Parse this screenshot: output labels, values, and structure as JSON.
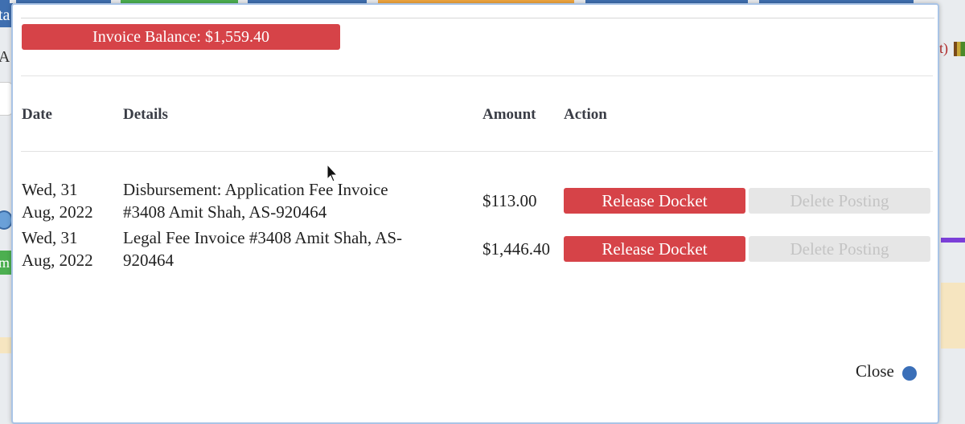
{
  "background": {
    "left_tab_text": "ta",
    "left_text": "Au",
    "left_green_text": "m",
    "right_text": "t)"
  },
  "modal": {
    "balance_label": "Invoice Balance: $1,559.40",
    "table": {
      "headers": {
        "date": "Date",
        "details": "Details",
        "amount": "Amount",
        "action": "Action"
      },
      "rows": [
        {
          "date_line1": "Wed, 31",
          "date_line2": "Aug, 2022",
          "details_line1": "Disbursement: Application Fee Invoice",
          "details_line2": "#3408 Amit Shah, AS-920464",
          "amount": "$113.00",
          "release_label": "Release Docket",
          "delete_label": "Delete Posting"
        },
        {
          "date_line1": "Wed, 31",
          "date_line2": "Aug, 2022",
          "details_line1": "Legal Fee Invoice #3408 Amit Shah, AS-",
          "details_line2": "920464",
          "amount": "$1,446.40",
          "release_label": "Release Docket",
          "delete_label": "Delete Posting"
        }
      ]
    },
    "close_label": "Close"
  },
  "colors": {
    "danger": "#d64348",
    "disabled_bg": "#e6e6e6",
    "disabled_text": "#c4c4c4",
    "header_text": "#3a3d46"
  }
}
